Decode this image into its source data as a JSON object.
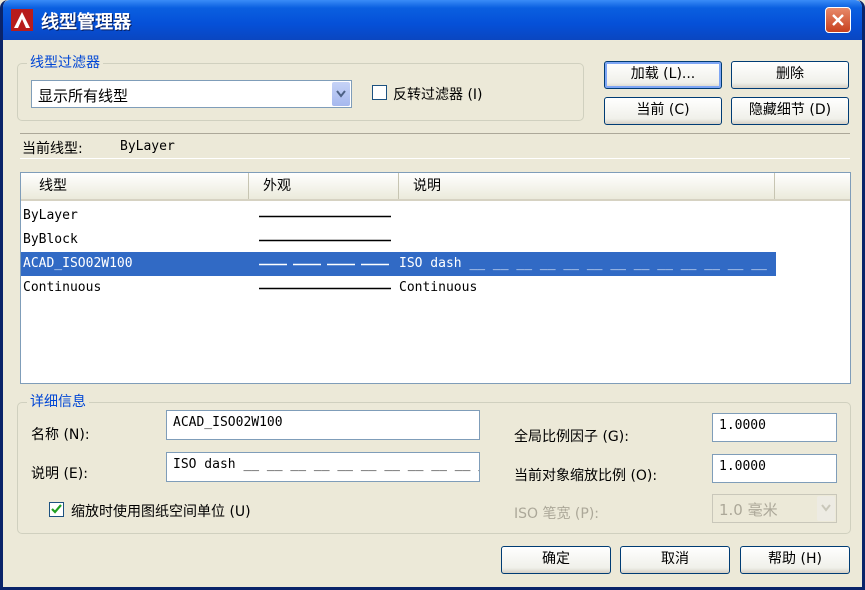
{
  "window": {
    "title": "线型管理器"
  },
  "filter": {
    "group_label": "线型过滤器",
    "selected": "显示所有线型",
    "invert_label": "反转过滤器",
    "invert_hotkey": "(I)",
    "invert_checked": false
  },
  "buttons": {
    "load": "加载 (L)...",
    "delete": "删除",
    "current": "当前 (C)",
    "hide_details": "隐藏细节 (D)",
    "ok": "确定",
    "cancel": "取消",
    "help": "帮助 (H)"
  },
  "current_linetype": {
    "label": "当前线型:",
    "value": "ByLayer"
  },
  "list": {
    "columns": [
      "线型",
      "外观",
      "说明"
    ],
    "rows": [
      {
        "name": "ByLayer",
        "appearance": "solid",
        "description": ""
      },
      {
        "name": "ByBlock",
        "appearance": "solid",
        "description": ""
      },
      {
        "name": "ACAD_ISO02W100",
        "appearance": "dash",
        "description": "ISO dash __ __ __ __ __ __ __ __ __ __ __ __ __",
        "selected": true
      },
      {
        "name": "Continuous",
        "appearance": "solid",
        "description": "Continuous"
      }
    ]
  },
  "details": {
    "group_label": "详细信息",
    "name_label": "名称 (N):",
    "name_value": "ACAD_ISO02W100",
    "desc_label": "说明 (E):",
    "desc_value": "ISO dash __ __ __ __ __ __ __ __ __ __ _",
    "global_scale_label": "全局比例因子 (G):",
    "global_scale_value": "1.0000",
    "object_scale_label": "当前对象缩放比例 (O):",
    "object_scale_value": "1.0000",
    "paper_units_label": "缩放时使用图纸空间单位 (U)",
    "paper_units_checked": true,
    "pen_width_label": "ISO 笔宽 (P):",
    "pen_width_value": "1.0 毫米"
  },
  "colors": {
    "title_bar": "#0550D8",
    "selection": "#316AC5",
    "group_label": "#0046D5",
    "close_button": "#C8401E"
  },
  "icons": {
    "app": "autocad-logo-icon",
    "close": "close-icon",
    "dropdown": "chevron-down-icon",
    "check": "checkmark-icon"
  }
}
